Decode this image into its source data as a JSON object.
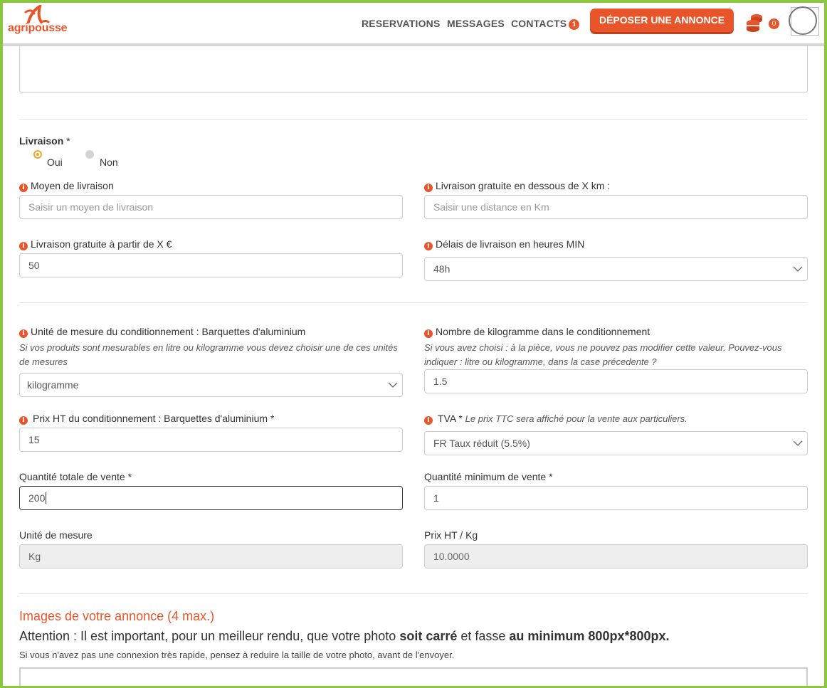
{
  "brand": {
    "logo_text": "agripousse",
    "accent": "#e8552a",
    "frame_green": "#8dc63f"
  },
  "nav": {
    "reservations": "RESERVATIONS",
    "messages": "MESSAGES",
    "contacts": "CONTACTS",
    "contacts_badge": "1",
    "cta": "DÉPOSER UNE ANNONCE",
    "coins_count": "0"
  },
  "livraison": {
    "label": "Livraison",
    "required": "*",
    "options": [
      {
        "label": "Oui",
        "selected": true
      },
      {
        "label": "Non",
        "selected": false
      }
    ]
  },
  "fields": {
    "moyen": {
      "label": "Moyen de livraison",
      "placeholder": "Saisir un moyen de livraison"
    },
    "gratuite_km": {
      "label": "Livraison gratuite en dessous de X km :",
      "placeholder": "Saisir une distance en Km"
    },
    "gratuite_eur": {
      "label": "Livraison gratuite à partir de X €",
      "value": "50"
    },
    "delais": {
      "label": "Délais de livraison en heures MIN",
      "value": "48h"
    },
    "unite_cond": {
      "label": "Unité de mesure du conditionnement : Barquettes d'aluminium",
      "help": "Si vos produits sont mesurables en litre ou kilogramme vous devez choisir une de ces unités de mesures",
      "value": "kilogramme"
    },
    "nb_kg": {
      "label": "Nombre de kilogramme dans le conditionnement",
      "help": "Si vous avez choisi : à la pièce, vous ne pouvez pas modifier cette valeur. Pouvez-vous indiquer : litre ou kilogramme, dans la case précedente ?",
      "value": "1.5"
    },
    "prix_ht": {
      "label": "Prix HT du conditionnement : Barquettes d'aluminium",
      "required": "*",
      "value": "15"
    },
    "tva": {
      "label": "TVA",
      "required": "*",
      "help": "Le prix TTC sera affiché pour la vente aux particuliers.",
      "value": "FR Taux réduit (5.5%)"
    },
    "qte_totale": {
      "label": "Quantité totale de vente",
      "required": "*",
      "value": "200"
    },
    "qte_min": {
      "label": "Quantité minimum de vente",
      "required": "*",
      "value": "1"
    },
    "unite": {
      "label": "Unité de mesure",
      "value": "Kg"
    },
    "prix_kg": {
      "label": "Prix HT / Kg",
      "value": "10.0000"
    }
  },
  "images": {
    "title": "Images de votre annonce (4 max.)",
    "attention_pre": "Attention : Il est important, pour un meilleur rendu, que votre photo ",
    "attention_b1": "soit carré",
    "attention_mid": " et fasse ",
    "attention_b2": "au minimum 800px*800px.",
    "note": "Si vous n'avez pas une connexion très rapide, pensez à reduire la taille de votre photo, avant de l'envoyer."
  }
}
